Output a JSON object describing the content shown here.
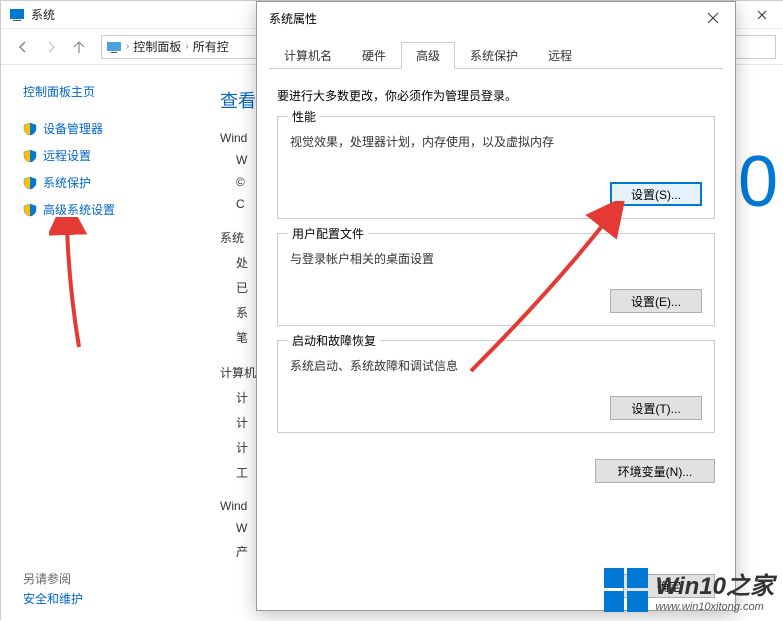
{
  "explorer": {
    "title": "系统",
    "breadcrumb": {
      "cp": "控制面板",
      "all": "所有控"
    },
    "sidebar": {
      "home": "控制面板主页",
      "items": [
        {
          "label": "设备管理器"
        },
        {
          "label": "远程设置"
        },
        {
          "label": "系统保护"
        },
        {
          "label": "高级系统设置"
        }
      ],
      "see_also_heading": "另请参阅",
      "see_also_link": "安全和维护"
    },
    "main": {
      "heading": "查看",
      "line_wind": "Wind",
      "line_w": "W",
      "line_copy": "©",
      "line_c": "C",
      "section_sys": "系统",
      "lines_sys": [
        "处",
        "已",
        "系",
        "笔"
      ],
      "section_comp": "计算机",
      "lines_comp": [
        "计",
        "计",
        "计",
        "工"
      ],
      "section_act": "Wind",
      "lines_act": [
        "W",
        "产"
      ],
      "big_zero": "0"
    }
  },
  "dialog": {
    "title": "系统属性",
    "tabs": {
      "computer_name": "计算机名",
      "hardware": "硬件",
      "advanced": "高级",
      "system_protection": "系统保护",
      "remote": "远程"
    },
    "intro": "要进行大多数更改，你必须作为管理员登录。",
    "perf": {
      "title": "性能",
      "desc": "视觉效果，处理器计划，内存使用，以及虚拟内存",
      "btn": "设置(S)..."
    },
    "profile": {
      "title": "用户配置文件",
      "desc": "与登录帐户相关的桌面设置",
      "btn": "设置(E)..."
    },
    "startup": {
      "title": "启动和故障恢复",
      "desc": "系统启动、系统故障和调试信息",
      "btn": "设置(T)..."
    },
    "env_btn": "环境变量(N)...",
    "footer": {
      "ok": "确定"
    }
  },
  "watermark": {
    "big": "Win10之家",
    "small": "www.win10xitong.com"
  }
}
